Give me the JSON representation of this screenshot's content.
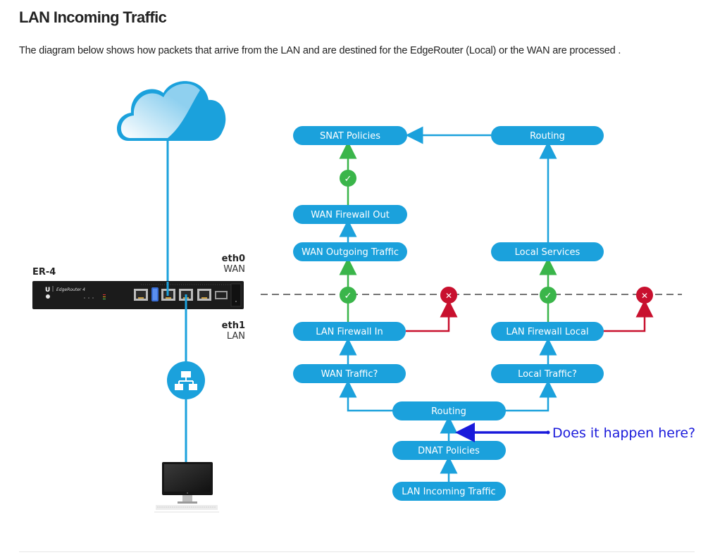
{
  "page": {
    "title": "LAN Incoming Traffic",
    "intro": "The diagram below shows how packets that arrive from the LAN and are destined for the EdgeRouter (Local) or the WAN are processed ."
  },
  "colors": {
    "node_fill": "#1ba1dc",
    "flow_line": "#1ba1dc",
    "accept": "#3ab54a",
    "drop": "#c8102e",
    "annotation": "#1a1adb",
    "router_body": "#1b1b1b"
  },
  "device": {
    "name": "ER-4",
    "brand_mark": "U",
    "model": "EdgeRouter 4",
    "ports": [
      {
        "name": "eth0",
        "role": "WAN"
      },
      {
        "name": "eth1",
        "role": "LAN"
      }
    ]
  },
  "icons": {
    "cloud": "cloud-icon",
    "network": "network-hub-icon",
    "computer": "desktop-computer-icon",
    "accept": "check-icon",
    "drop": "x-icon"
  },
  "flow": {
    "nodes": {
      "snat": "SNAT Policies",
      "routing_top": "Routing",
      "wan_fw_out": "WAN Firewall Out",
      "wan_out": "WAN Outgoing Traffic",
      "local_services": "Local Services",
      "lan_fw_in": "LAN Firewall In",
      "lan_fw_local": "LAN Firewall Local",
      "wan_traffic_q": "WAN Traffic?",
      "local_traffic_q": "Local Traffic?",
      "routing_bottom": "Routing",
      "dnat": "DNAT Policies",
      "lan_in": "LAN Incoming Traffic"
    },
    "decisions": {
      "accept_symbol": "✓",
      "drop_symbol": "✕"
    }
  },
  "annotation": {
    "text": "Does it happen here?"
  }
}
